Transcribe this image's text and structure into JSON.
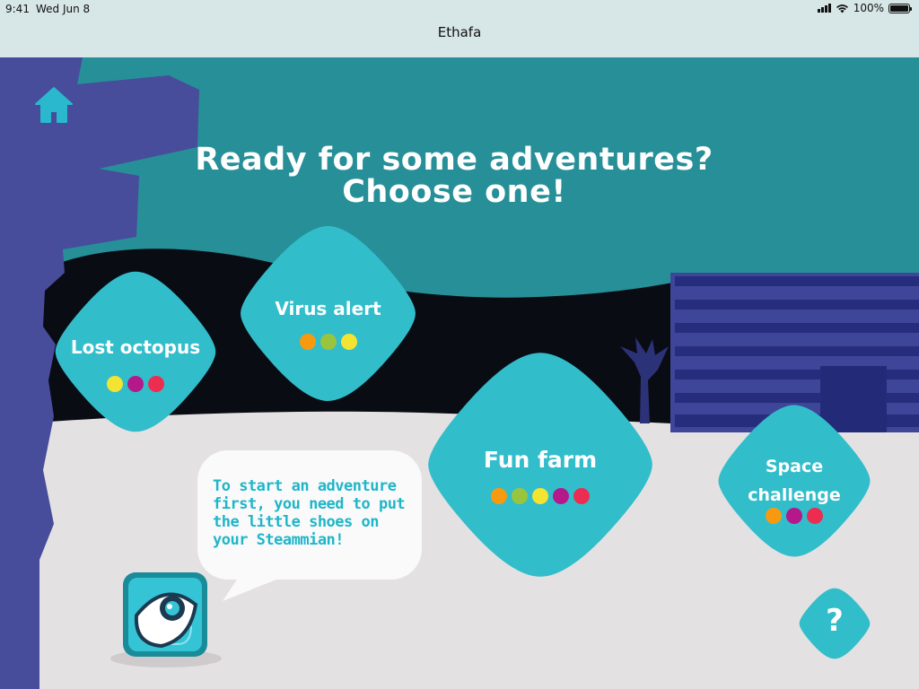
{
  "status_bar": {
    "time": "9:41",
    "date": "Wed Jun 8",
    "battery": "100%",
    "battery_level": 1.0
  },
  "app": {
    "title": "Ethafa"
  },
  "headline": {
    "line1": "Ready for some adventures?",
    "line2": "Choose one!"
  },
  "adventures": [
    {
      "name": "Lost octopus",
      "difficulty_colors": [
        "#f3e431",
        "#b5188a",
        "#ec2c50"
      ]
    },
    {
      "name": "Virus alert",
      "difficulty_colors": [
        "#f79a10",
        "#99c53e",
        "#f3e431"
      ]
    },
    {
      "name": "Fun farm",
      "difficulty_colors": [
        "#f79a10",
        "#99c53e",
        "#f3e431",
        "#b5188a",
        "#ec2c50"
      ]
    },
    {
      "name": "Space challenge",
      "name_line1": "Space",
      "name_line2": "challenge",
      "difficulty_colors": [
        "#f79a10",
        "#b5188a",
        "#ec2c50"
      ]
    }
  ],
  "hint": {
    "text": "To start an adventure first, you need to put the little shoes on your Steammian!"
  },
  "help": {
    "label": "?"
  },
  "icons": {
    "home": "home-icon",
    "help": "question-mark-icon",
    "robot": "steammian-robot-icon",
    "wifi": "wifi-icon",
    "signal": "signal-icon",
    "battery": "battery-icon"
  },
  "colors": {
    "sky": "#278f98",
    "tree": "#474c9b",
    "cave": "#0a0c14",
    "ground": "#e4e1e2",
    "blob": "#32bdcb",
    "building": "#3e469a",
    "accent_text": "#1fb6c9"
  }
}
